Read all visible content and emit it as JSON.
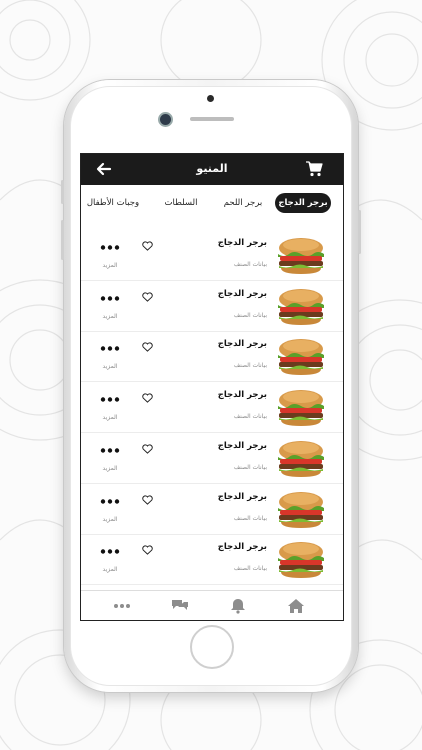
{
  "header": {
    "title": "المنيو",
    "back_icon": "arrow-left-icon",
    "cart_icon": "cart-icon"
  },
  "tabs": [
    {
      "label": "برجر الدجاج",
      "active": true
    },
    {
      "label": "برجر اللحم",
      "active": false
    },
    {
      "label": "السلطات",
      "active": false
    },
    {
      "label": "وجبات الأطفال",
      "active": false
    }
  ],
  "items": [
    {
      "name": "برجر الدجاج",
      "subtitle": "بيانات الصنف",
      "more_label": "المزيد"
    },
    {
      "name": "برجر الدجاج",
      "subtitle": "بيانات الصنف",
      "more_label": "المزيد"
    },
    {
      "name": "برجر الدجاج",
      "subtitle": "بيانات الصنف",
      "more_label": "المزيد"
    },
    {
      "name": "برجر الدجاج",
      "subtitle": "بيانات الصنف",
      "more_label": "المزيد"
    },
    {
      "name": "برجر الدجاج",
      "subtitle": "بيانات الصنف",
      "more_label": "المزيد"
    },
    {
      "name": "برجر الدجاج",
      "subtitle": "بيانات الصنف",
      "more_label": "المزيد"
    },
    {
      "name": "برجر الدجاج",
      "subtitle": "بيانات الصنف",
      "more_label": "المزيد"
    }
  ],
  "bottom_nav": [
    "more-icon",
    "chat-icon",
    "bell-icon",
    "home-icon"
  ],
  "colors": {
    "header": "#1b1b1b",
    "active_tab": "#1b1b1b",
    "icon": "#8d8d8d"
  }
}
